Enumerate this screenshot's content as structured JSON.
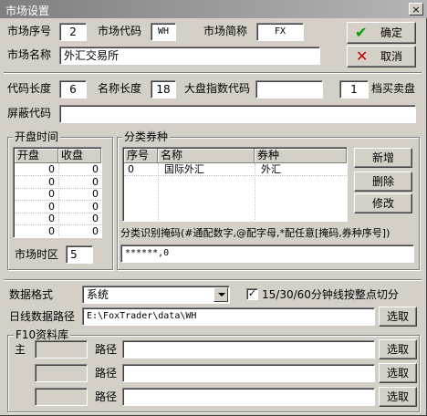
{
  "window": {
    "title": "市场设置",
    "close_glyph": "×"
  },
  "market": {
    "seq_label": "市场序号",
    "seq_value": "2",
    "code_label": "市场代码",
    "code_value": "WH",
    "abbr_label": "市场简称",
    "abbr_value": "FX",
    "name_label": "市场名称",
    "name_value": "外汇交易所"
  },
  "buttons": {
    "ok": "确定",
    "cancel": "取消",
    "add": "新增",
    "delete": "删除",
    "modify": "修改",
    "browse": "选取"
  },
  "lengths": {
    "code_len_label": "代码长度",
    "code_len": "6",
    "name_len_label": "名称长度",
    "name_len": "18",
    "index_code_label": "大盘指数代码",
    "index_code": "",
    "level_value": "1",
    "level_label": "档买卖盘"
  },
  "mask": {
    "label": "屏蔽代码",
    "value": ""
  },
  "trading_time": {
    "title": "开盘时间",
    "col_open": "开盘",
    "col_close": "收盘",
    "rows": [
      [
        "0",
        "0"
      ],
      [
        "0",
        "0"
      ],
      [
        "0",
        "0"
      ],
      [
        "0",
        "0"
      ],
      [
        "0",
        "0"
      ],
      [
        "0",
        "0"
      ]
    ],
    "timezone_label": "市场时区",
    "timezone_value": "5"
  },
  "category": {
    "title": "分类券种",
    "col_seq": "序号",
    "col_name": "名称",
    "col_type": "券种",
    "rows": [
      {
        "seq": "0",
        "name": "国际外汇",
        "type": "外汇"
      }
    ],
    "pattern_label": "分类识别掩码(#通配数字,@配字母,*配任意[掩码,券种序号])",
    "pattern_value": "******,0"
  },
  "format": {
    "label": "数据格式",
    "value": "系统",
    "checkbox_label": "15/30/60分钟线按整点切分",
    "checkbox_checked": true,
    "daypath_label": "日线数据路径",
    "daypath_value": "E:\\FoxTrader\\data\\WH"
  },
  "f10": {
    "title": "F10资料库",
    "main_label": "主",
    "path_label": "路径",
    "rows": [
      {
        "name": "",
        "path": ""
      },
      {
        "name": "",
        "path": ""
      },
      {
        "name": "",
        "path": ""
      }
    ]
  },
  "colors": {
    "ok_check": "#00a000",
    "cancel_x": "#c00000"
  }
}
